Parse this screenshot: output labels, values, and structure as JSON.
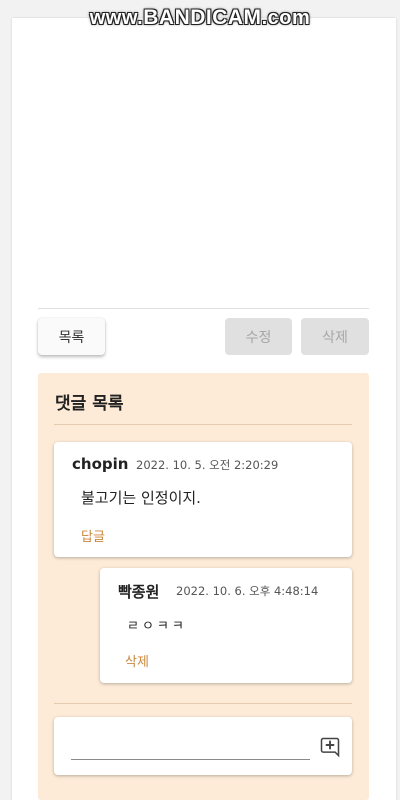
{
  "watermark": {
    "prefix": "www.",
    "brand": "BANDICAM",
    "suffix": ".com"
  },
  "toolbar": {
    "list_label": "목록",
    "edit_label": "수정",
    "delete_label": "삭제"
  },
  "comments": {
    "title": "댓글 목록",
    "items": [
      {
        "author": "chopin",
        "timestamp": "2022. 10. 5. 오전 2:20:29",
        "content": "불고기는 인정이지.",
        "action": "답글"
      }
    ],
    "replies": [
      {
        "author": "빡종원",
        "timestamp": "2022. 10. 6. 오후 4:48:14",
        "content": "ㄹㅇㅋㅋ",
        "action": "삭제"
      }
    ],
    "new_comment": {
      "value": "",
      "placeholder": ""
    }
  },
  "colors": {
    "panel_bg": "#fdebd7",
    "link": "#c9883f",
    "disabled_bg": "#e0e0e0"
  },
  "icons": {
    "add_comment": "add-comment-icon"
  }
}
